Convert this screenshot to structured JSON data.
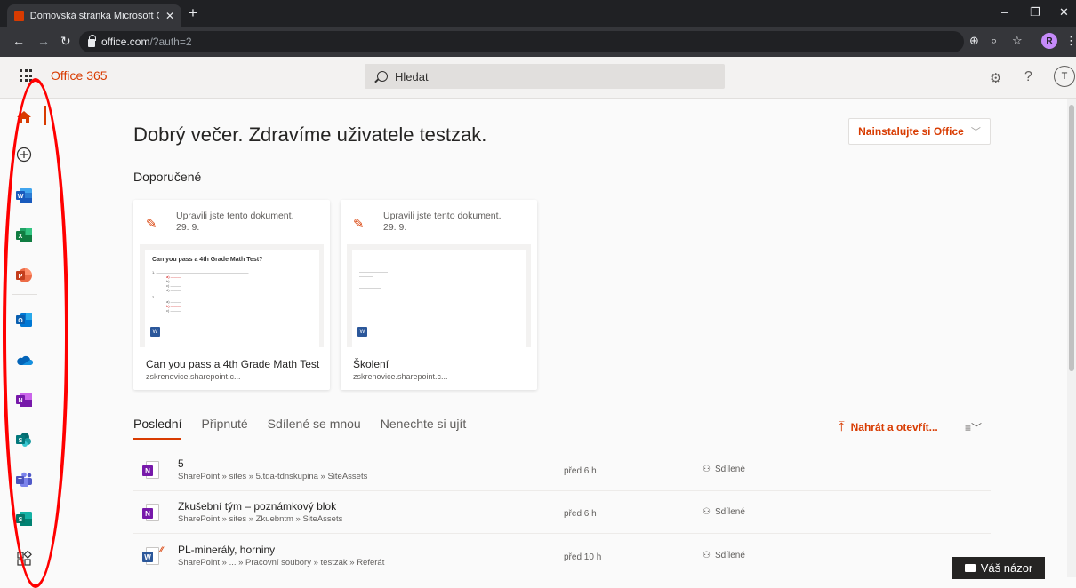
{
  "browser": {
    "tab_title": "Domovská stránka Microsoft Offi",
    "tab_close": "✕",
    "new_tab": "+",
    "url_host": "office.com",
    "url_path": "/?auth=2",
    "profile_initial": "R",
    "window_controls": {
      "minimize": "–",
      "restore": "❐",
      "close": "✕"
    }
  },
  "header": {
    "brand": "Office 365",
    "search_placeholder": "Hledat",
    "user_initial": "T"
  },
  "rail": {
    "items": [
      "home",
      "create",
      "word",
      "excel",
      "powerpoint",
      "outlook",
      "onedrive",
      "onenote",
      "sharepoint",
      "teams",
      "sway",
      "all-apps"
    ]
  },
  "main": {
    "greeting": "Dobrý večer. Zdravíme uživatele testzak.",
    "install_button": "Nainstalujte si Office",
    "recommended_title": "Doporučené",
    "cards": [
      {
        "activity": "Upravili jste tento dokument.",
        "date": "29. 9.",
        "title": "Can you pass a 4th Grade Math Test",
        "site": "zskrenovice.sharepoint.c...",
        "thumb_heading": "Can you pass a 4th Grade Math Test?"
      },
      {
        "activity": "Upravili jste tento dokument.",
        "date": "29. 9.",
        "title": "Školení",
        "site": "zskrenovice.sharepoint.c..."
      }
    ],
    "tabs": [
      "Poslední",
      "Připnuté",
      "Sdílené se mnou",
      "Nenechte si ujít"
    ],
    "upload_button": "Nahrát a otevřít...",
    "files": [
      {
        "name": "5",
        "path": "SharePoint » sites » 5.tda-tdnskupina » SiteAssets",
        "time": "před 6 h",
        "shared": "Sdílené",
        "app": "N"
      },
      {
        "name": "Zkušební tým – poznámkový blok",
        "path": "SharePoint » sites » Zkuebntm » SiteAssets",
        "time": "před 6 h",
        "shared": "Sdílené",
        "app": "N"
      },
      {
        "name": "PL-minerály, horniny",
        "path": "SharePoint » ... » Pracovní soubory » testzak » Referát",
        "time": "před 10 h",
        "shared": "Sdílené",
        "app": "W"
      }
    ],
    "feedback": "Váš názor"
  },
  "colors": {
    "accent": "#d83b01",
    "word": "#2b579a",
    "excel": "#217346",
    "powerpoint": "#d24726",
    "outlook": "#0078d4",
    "onenote": "#7719aa",
    "sharepoint": "#038387",
    "teams": "#5558af",
    "annotation": "#ff0000"
  }
}
